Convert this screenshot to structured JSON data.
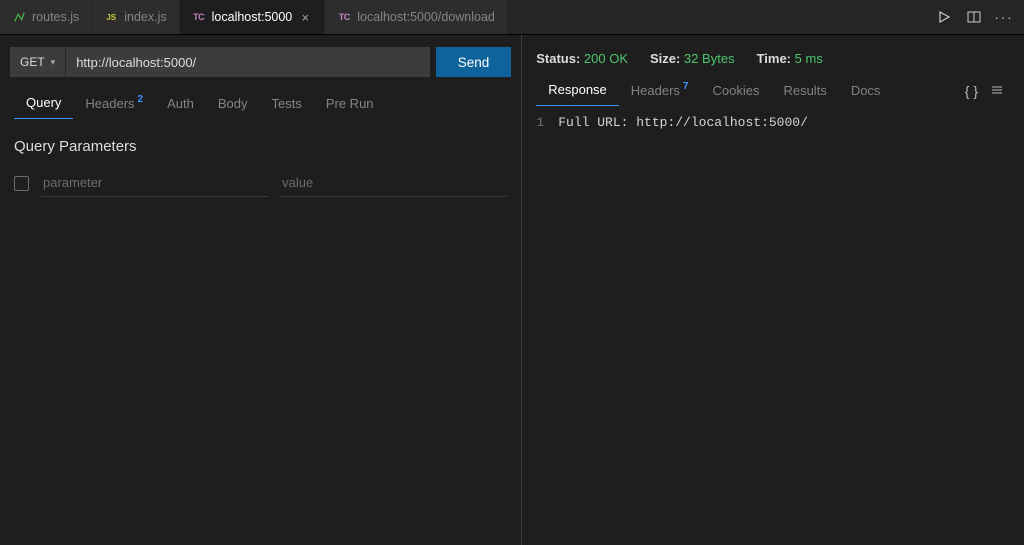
{
  "tabs": [
    {
      "icon": "routes",
      "label": "routes.js"
    },
    {
      "icon": "js",
      "label": "index.js"
    },
    {
      "icon": "tc",
      "label": "localhost:5000",
      "active": true
    },
    {
      "icon": "tc",
      "label": "localhost:5000/download"
    }
  ],
  "request": {
    "method": "GET",
    "url": "http://localhost:5000/",
    "send_label": "Send",
    "tabs": [
      "Query",
      "Headers",
      "Auth",
      "Body",
      "Tests",
      "Pre Run"
    ],
    "headers_badge": "2",
    "active_tab": "Query",
    "section_title": "Query Parameters",
    "param_placeholder_key": "parameter",
    "param_placeholder_value": "value"
  },
  "response": {
    "status_label": "Status:",
    "status_value": "200 OK",
    "size_label": "Size:",
    "size_value": "32 Bytes",
    "time_label": "Time:",
    "time_value": "5 ms",
    "tabs": [
      "Response",
      "Headers",
      "Cookies",
      "Results",
      "Docs"
    ],
    "headers_badge": "7",
    "active_tab": "Response",
    "body_line1": "Full URL: http://localhost:5000/"
  }
}
